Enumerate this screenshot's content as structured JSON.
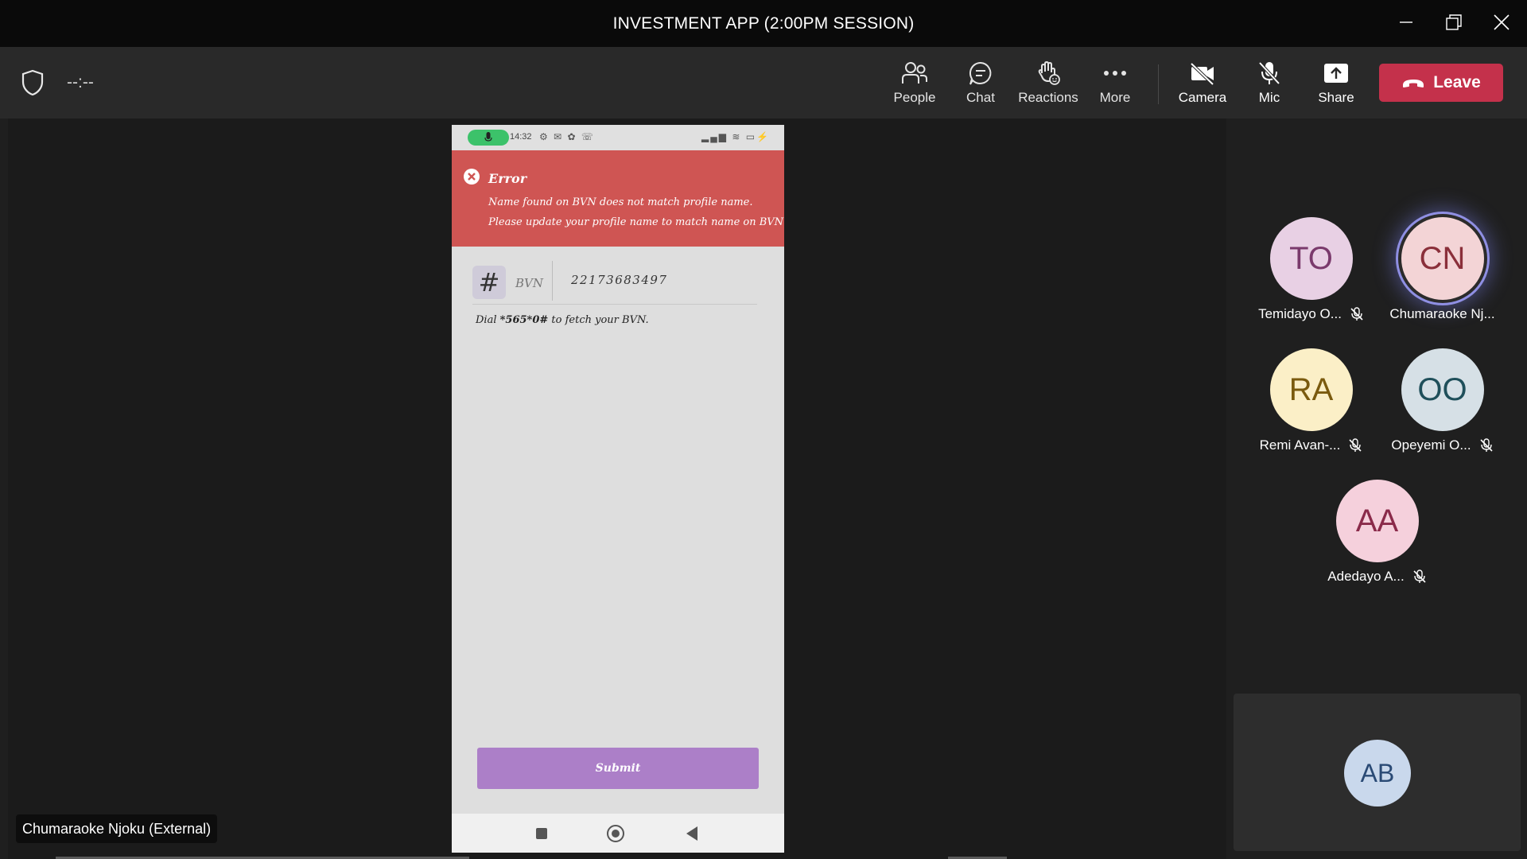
{
  "window": {
    "title": "INVESTMENT APP (2:00PM SESSION)"
  },
  "toolbar": {
    "timer": "--:--",
    "people": "People",
    "chat": "Chat",
    "reactions": "Reactions",
    "more": "More",
    "camera": "Camera",
    "mic": "Mic",
    "share": "Share",
    "leave": "Leave"
  },
  "phone": {
    "status_time": "14:32",
    "error": {
      "title": "Error",
      "line1": "Name found on BVN does not match profile name.",
      "line2": "Please update your profile name to match name on BVN"
    },
    "bvn_label": "BVN",
    "bvn_value": "22173683497",
    "dial_prefix": "Dial ",
    "dial_code": "*565*0#",
    "dial_suffix": " to fetch your BVN.",
    "submit": "Submit"
  },
  "presenter": {
    "name": "Chumaraoke Njoku (External)"
  },
  "participants": [
    {
      "initials": "TO",
      "name": "Temidayo O...",
      "muted": true,
      "color": "#e8d0e4",
      "text_color": "#7a3a6c"
    },
    {
      "initials": "CN",
      "name": "Chumaraoke Nj...",
      "muted": false,
      "color": "#f3d4d6",
      "text_color": "#8a2f3a"
    },
    {
      "initials": "RA",
      "name": "Remi Avan-...",
      "muted": true,
      "color": "#fbefc7",
      "text_color": "#7a5a0e"
    },
    {
      "initials": "OO",
      "name": "Opeyemi O...",
      "muted": true,
      "color": "#d6e0e6",
      "text_color": "#1f4f5a"
    },
    {
      "initials": "AA",
      "name": "Adedayo A...",
      "muted": true,
      "color": "#f5d0dc",
      "text_color": "#8a2a4a"
    }
  ],
  "self_tile": {
    "initials": "AB",
    "color": "#c9d8ec",
    "text_color": "#2a4a75"
  }
}
